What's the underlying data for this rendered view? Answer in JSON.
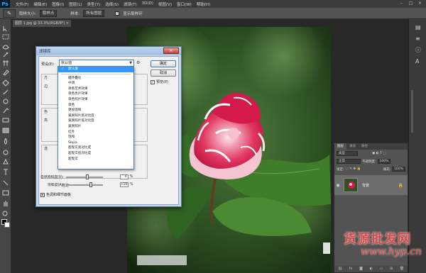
{
  "app": {
    "logo": "Ps"
  },
  "menu": {
    "items": [
      "文件(F)",
      "编辑(E)",
      "图像(I)",
      "图层(L)",
      "类型(Y)",
      "选择(S)",
      "滤镜(T)",
      "3D(D)",
      "视图(V)",
      "窗口(W)",
      "帮助(H)"
    ]
  },
  "window_controls": [
    "–",
    "□",
    "×"
  ],
  "options": {
    "sample_size_label": "取样大小:",
    "sample_size_value": "取样点",
    "sample_label": "样本:",
    "sample_value": "所有图层",
    "show_ring_label": "显示取样环"
  },
  "document": {
    "tab_label": "图层 1.jpg @ 33.3%(RGB/8*) ×"
  },
  "dialog": {
    "title": "滤镜库",
    "close": "×",
    "filter_label": "预设(E):",
    "filter_selected": "默认值",
    "ok_button": "确定",
    "cancel_button": "取消",
    "preview_label": "预览(P)",
    "bg_labels": [
      "方",
      "边",
      "色",
      "高",
      "选"
    ],
    "dropdown_items": [
      "默认值",
      "循环叠化",
      "中调",
      "单色艺术效果",
      "单色负片效果",
      "单色照片效果",
      "单色",
      "更加饱和",
      "逼真照片高对比度",
      "逼真照片低对比度",
      "逼真照片",
      "红外",
      "饱和",
      "Sepia",
      "超现实高对比度",
      "超现实低对比度",
      "超现实"
    ],
    "sliders": [
      {
        "label": "自然饱和度(V):",
        "value": "0",
        "unit": "%"
      },
      {
        "label": "饱和度(A):",
        "value": "+20",
        "unit": "%"
      }
    ],
    "bottom_check_label": "色调和细节面板",
    "custom_label": "自定"
  },
  "layers_panel": {
    "tabs": [
      "图层",
      "通道",
      "路径"
    ],
    "kind_label": "类型",
    "blend_mode": "正常",
    "opacity_label": "不透明度:",
    "opacity_value": "100%",
    "lock_label": "锁定:",
    "fill_label": "填充:",
    "fill_value": "100%",
    "layer_name": "背景"
  },
  "watermark": {
    "text": "货源批发网",
    "url": "www.hyp.cn"
  },
  "colors": {
    "accent": "#3399ff",
    "dialog_bg": "#f0f0f0",
    "ui_dark": "#282828",
    "flower": "#d4194b"
  }
}
